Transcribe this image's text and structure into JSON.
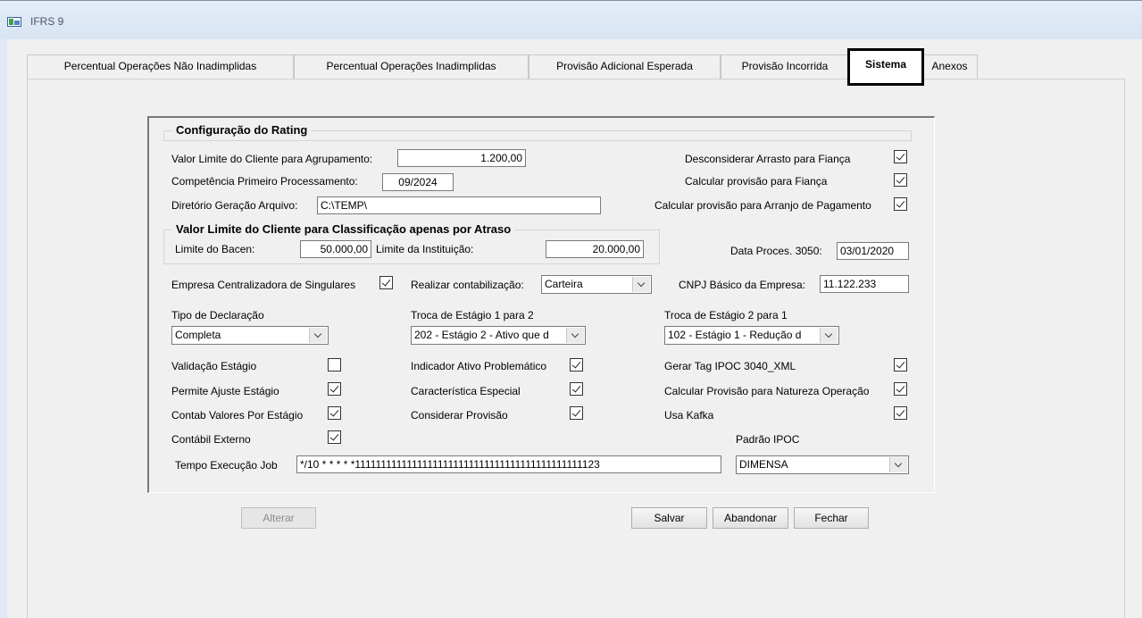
{
  "window": {
    "title": "IFRS 9"
  },
  "tabs": [
    {
      "label": "Percentual Operações Não Inadimplidas"
    },
    {
      "label": "Percentual Operações Inadimplidas"
    },
    {
      "label": "Provisão Adicional Esperada"
    },
    {
      "label": "Provisão Incorrida"
    },
    {
      "label": "Sistema"
    },
    {
      "label": "Anexos"
    }
  ],
  "rating": {
    "legend": "Configuração do Rating",
    "valor_limite_label": "Valor Limite do Cliente para Agrupamento:",
    "valor_limite_value": "1.200,00",
    "competencia_label": "Competência Primeiro Processamento:",
    "competencia_value": "09/2024",
    "diretorio_label": "Diretório Geração Arquivo:",
    "diretorio_value": "C:\\TEMP\\",
    "desconsiderar_label": "Desconsiderar Arrasto para Fiança",
    "desconsiderar_checked": true,
    "calcular_fianca_label": "Calcular provisão para Fiança",
    "calcular_fianca_checked": true,
    "calcular_arranjo_label": "Calcular provisão para Arranjo de Pagamento",
    "calcular_arranjo_checked": true
  },
  "atraso": {
    "legend": "Valor Limite do Cliente para Classificação apenas por Atraso",
    "bacen_label": "Limite do Bacen:",
    "bacen_value": "50.000,00",
    "instituicao_label": "Limite da Instituição:",
    "instituicao_value": "20.000,00"
  },
  "data_proces": {
    "label": "Data Proces. 3050:",
    "value": "03/01/2020"
  },
  "empresa_centralizadora": {
    "label": "Empresa Centralizadora de Singulares",
    "checked": true
  },
  "contabilizacao": {
    "label": "Realizar contabilização:",
    "value": "Carteira"
  },
  "cnpj": {
    "label": "CNPJ Básico da Empresa:",
    "value": "11.122.233"
  },
  "tipo_declaracao": {
    "label": "Tipo de Declaração",
    "value": "Completa"
  },
  "troca_1_2": {
    "label": "Troca de Estágio 1 para 2",
    "value": "202 - Estágio 2 - Ativo que d"
  },
  "troca_2_1": {
    "label": "Troca de Estágio 2 para 1",
    "value": "102 - Estágio 1 - Redução d"
  },
  "checks": {
    "validacao": {
      "label": "Validação Estágio",
      "checked": false
    },
    "permite_ajuste": {
      "label": "Permite Ajuste Estágio",
      "checked": true
    },
    "contab_valores": {
      "label": "Contab Valores Por Estágio",
      "checked": true
    },
    "contabil_externo": {
      "label": "Contábil Externo",
      "checked": true
    },
    "indicador_ativo": {
      "label": "Indicador Ativo Problemático",
      "checked": true
    },
    "caracteristica": {
      "label": "Característica Especial",
      "checked": true
    },
    "considerar_provisao": {
      "label": "Considerar Provisão",
      "checked": true
    },
    "gerar_tag": {
      "label": "Gerar Tag IPOC 3040_XML",
      "checked": true
    },
    "calcular_natureza": {
      "label": "Calcular Provisão para Natureza Operação",
      "checked": true
    },
    "usa_kafka": {
      "label": "Usa Kafka",
      "checked": true
    }
  },
  "padrao_ipoc": {
    "label": "Padrão IPOC",
    "value": "DIMENSA"
  },
  "tempo_execucao": {
    "label": "Tempo Execução Job",
    "value": "*/10 * * * * *11111111111111111111111111111111111111111111123"
  },
  "buttons": {
    "alterar": "Alterar",
    "salvar": "Salvar",
    "abandonar": "Abandonar",
    "fechar": "Fechar"
  }
}
